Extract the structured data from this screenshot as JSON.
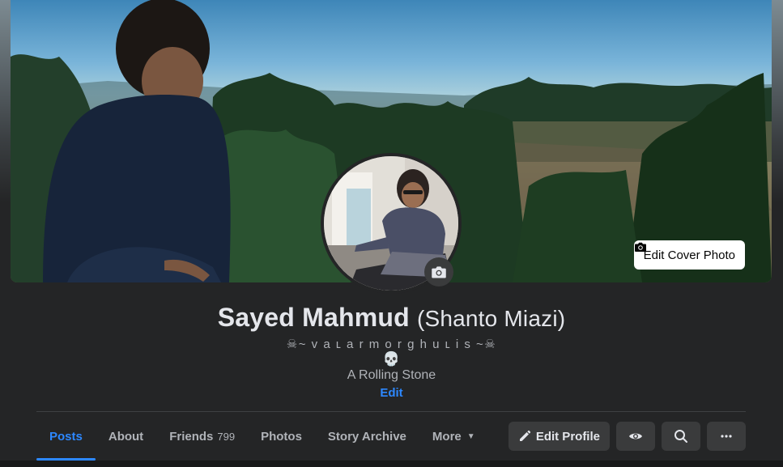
{
  "cover": {
    "edit_cover_label": "Edit Cover Photo",
    "icon": "camera-icon"
  },
  "avatar": {
    "icon": "camera-icon"
  },
  "profile": {
    "name": "Sayed Mahmud",
    "alternate_name": "(Shanto Miazi)",
    "tagline": "☠~ v a ʟ a r m o r g h u ʟ i s ~☠",
    "skull": "💀",
    "bio": "A Rolling Stone",
    "edit_label": "Edit"
  },
  "tabs": [
    {
      "label": "Posts",
      "active": true
    },
    {
      "label": "About"
    },
    {
      "label": "Friends",
      "count": "799"
    },
    {
      "label": "Photos"
    },
    {
      "label": "Story Archive"
    },
    {
      "label": "More",
      "icon": "caret-down-icon"
    }
  ],
  "actions": {
    "edit_profile_label": "Edit Profile",
    "view_as_icon": "eye-icon",
    "search_icon": "search-icon",
    "more_icon": "ellipsis-icon"
  },
  "colors": {
    "background": "#242526",
    "accent": "#2d88ff",
    "button_bg": "#3a3b3c",
    "text_primary": "#e4e6eb",
    "text_secondary": "#b0b3b8"
  }
}
